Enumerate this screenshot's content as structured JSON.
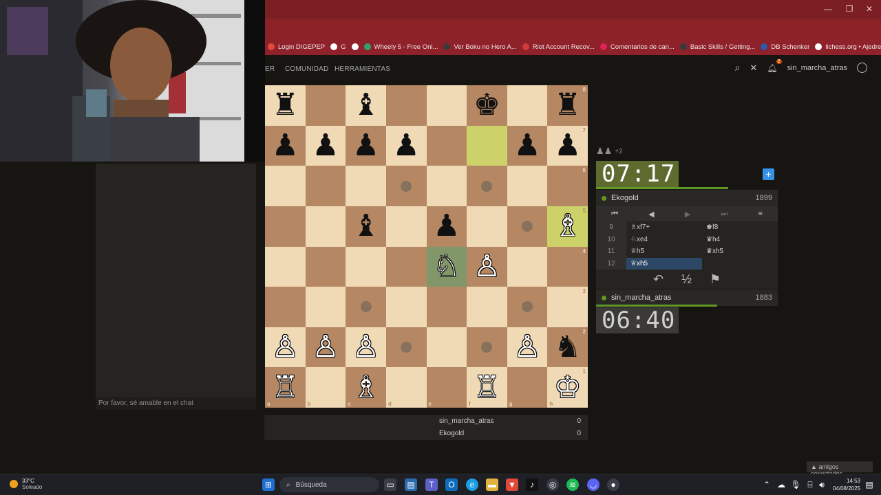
{
  "browser": {
    "bookmarks": [
      {
        "label": "Login DIGEPEP"
      },
      {
        "label": "G"
      },
      {
        "label": ""
      },
      {
        "label": "Wheely 5 - Free Onl..."
      },
      {
        "label": "Ver Boku no Hero A..."
      },
      {
        "label": "Riot Account Recov..."
      },
      {
        "label": "Comentarios de can..."
      },
      {
        "label": "Basic Skills / Getting..."
      },
      {
        "label": "DB Schenker"
      },
      {
        "label": "lichess.org • Ajedrez..."
      }
    ],
    "overflow": "»"
  },
  "header": {
    "nav": [
      "ER",
      "COMUNIDAD",
      "HERRAMIENTAS"
    ],
    "notification_count": "2",
    "username": "sin_marcha_atras"
  },
  "chat": {
    "placeholder": "Por favor, sé amable en el chat"
  },
  "board": {
    "files": [
      "a",
      "b",
      "c",
      "d",
      "e",
      "f",
      "g",
      "h"
    ],
    "ranks": [
      "8",
      "7",
      "6",
      "5",
      "4",
      "3",
      "2",
      "1"
    ],
    "squares": [
      [
        "♜",
        "",
        "♝",
        "",
        "",
        "♚",
        "",
        "♜"
      ],
      [
        "♟",
        "♟",
        "♟",
        "♟",
        "",
        "",
        "♟",
        "♟"
      ],
      [
        "",
        "",
        "",
        "",
        "",
        "",
        "",
        ""
      ],
      [
        "",
        "",
        "♝",
        "",
        "♟",
        "",
        "",
        "♗"
      ],
      [
        "",
        "",
        "",
        "",
        "♘",
        "♙",
        "",
        ""
      ],
      [
        "",
        "",
        "",
        "",
        "",
        "",
        "",
        ""
      ],
      [
        "♙",
        "♙",
        "♙",
        "",
        "",
        "",
        "♙",
        "♞"
      ],
      [
        "♖",
        "",
        "♗",
        "",
        "",
        "♖",
        "",
        "♔"
      ]
    ],
    "colors": [
      [
        "b",
        "",
        "b",
        "",
        "",
        "b",
        "",
        "b"
      ],
      [
        "b",
        "b",
        "b",
        "b",
        "",
        "",
        "b",
        "b"
      ],
      [
        "",
        "",
        "",
        "",
        "",
        "",
        "",
        ""
      ],
      [
        "",
        "",
        "b",
        "",
        "b",
        "",
        "",
        "w"
      ],
      [
        "",
        "",
        "",
        "",
        "w",
        "w",
        "",
        ""
      ],
      [
        "",
        "",
        "",
        "",
        "",
        "",
        "",
        ""
      ],
      [
        "w",
        "w",
        "w",
        "",
        "",
        "",
        "w",
        "b"
      ],
      [
        "w",
        "",
        "w",
        "",
        "",
        "w",
        "",
        "w"
      ]
    ],
    "highlights": [
      [
        1,
        5
      ],
      [
        3,
        7
      ]
    ],
    "selected": [
      4,
      4
    ],
    "move_dots": [
      [
        2,
        3
      ],
      [
        2,
        5
      ],
      [
        3,
        6
      ],
      [
        5,
        2
      ],
      [
        5,
        6
      ],
      [
        6,
        3
      ],
      [
        6,
        5
      ]
    ]
  },
  "game": {
    "spectators": "+2",
    "opponent": {
      "name": "Ekogold",
      "rating": "1899",
      "clock": "07:17"
    },
    "player": {
      "name": "sin_marcha_atras",
      "rating": "1883",
      "clock": "06:40"
    },
    "moves": [
      {
        "num": "9",
        "white": "♗xf7+",
        "black": "♚f8",
        "active": false
      },
      {
        "num": "10",
        "white": "♘xe4",
        "black": "♛h4",
        "active": false
      },
      {
        "num": "11",
        "white": "♕h5",
        "black": "♛xh5",
        "active": false
      },
      {
        "num": "12",
        "white": "♕xh5",
        "black": "",
        "active": true
      }
    ],
    "controls": [
      "⏮",
      "◀",
      "▶",
      "⏭",
      "≡"
    ],
    "actions": [
      "↶",
      "½",
      "⚑"
    ]
  },
  "scores": [
    {
      "name": "sin_marcha_atras",
      "score": "0"
    },
    {
      "name": "Ekogold",
      "score": "0"
    }
  ],
  "friends": "▲ amigos conectados",
  "taskbar": {
    "weather_temp": "33°C",
    "weather_desc": "Soleado",
    "search_label": "Búsqueda",
    "time": "14:53",
    "date": "04/08/2025"
  },
  "colors": {
    "light_square": "#f0d9b5",
    "dark_square": "#b58863",
    "accent": "#629924",
    "brand_red": "#8c2128"
  }
}
